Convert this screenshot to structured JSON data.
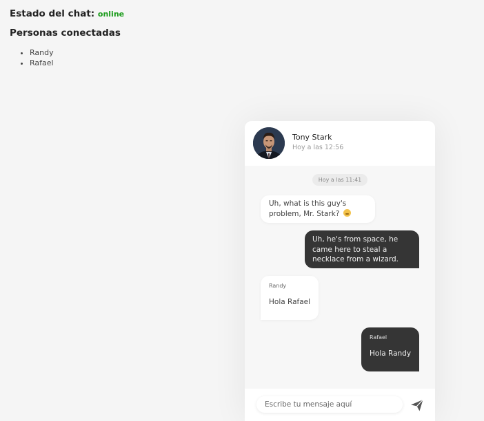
{
  "status": {
    "label": "Estado del chat:",
    "value": "online"
  },
  "people": {
    "title": "Personas conectadas",
    "items": [
      "Randy",
      "Rafael"
    ]
  },
  "chat": {
    "contact": {
      "name": "Tony Stark",
      "time": "Hoy a las 12:56"
    },
    "date_separator": "Hoy a las 11:41",
    "messages": [
      {
        "direction": "in",
        "text": "Uh, what is this guy's problem, Mr. Stark?",
        "emoji": "thinking-face"
      },
      {
        "direction": "out",
        "text": "Uh, he's from space, he came here to steal a necklace from a wizard."
      },
      {
        "direction": "in",
        "sender": "Randy",
        "text": "Hola Rafael"
      },
      {
        "direction": "out",
        "sender": "Rafael",
        "text": "Hola Randy"
      }
    ],
    "composer": {
      "placeholder": "Escribe tu mensaje aquí",
      "value": ""
    }
  },
  "colors": {
    "online": "#1a9b1a",
    "outgoing_bubble": "#353535",
    "incoming_bubble": "#ffffff"
  }
}
